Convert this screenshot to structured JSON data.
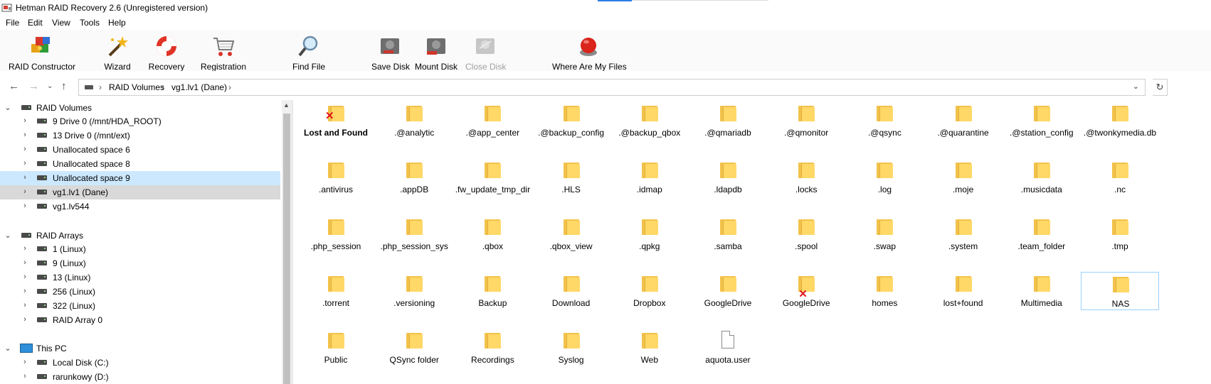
{
  "window": {
    "title": "Hetman RAID Recovery 2.6 (Unregistered version)"
  },
  "menu": [
    "File",
    "Edit",
    "View",
    "Tools",
    "Help"
  ],
  "toolbar": [
    {
      "label": "RAID Constructor",
      "icon": "raid-constructor-icon",
      "enabled": true
    },
    {
      "label": "Wizard",
      "icon": "wizard-icon",
      "enabled": true
    },
    {
      "label": "Recovery",
      "icon": "recovery-lifebuoy-icon",
      "enabled": true
    },
    {
      "label": "Registration",
      "icon": "cart-icon",
      "enabled": true
    },
    {
      "label": "Find File",
      "icon": "magnifier-icon",
      "enabled": true
    },
    {
      "label": "Save Disk",
      "icon": "save-disk-icon",
      "enabled": true
    },
    {
      "label": "Mount Disk",
      "icon": "mount-disk-icon",
      "enabled": true
    },
    {
      "label": "Close Disk",
      "icon": "close-disk-icon",
      "enabled": false
    },
    {
      "label": "Where Are My Files",
      "icon": "help-button-icon",
      "enabled": true
    }
  ],
  "address": {
    "segments": [
      "RAID Volumes",
      "vg1.lv1 (Dane)"
    ]
  },
  "tree": {
    "raid_volumes": {
      "label": "RAID Volumes",
      "items": [
        "9 Drive 0 (/mnt/HDA_ROOT)",
        "13 Drive 0 (/mnt/ext)",
        "Unallocated space 6",
        "Unallocated space 8",
        "Unallocated space 9",
        "vg1.lv1 (Dane)",
        "vg1.lv544"
      ]
    },
    "raid_arrays": {
      "label": "RAID Arrays",
      "items": [
        "1 (Linux)",
        "9 (Linux)",
        "13 (Linux)",
        "256 (Linux)",
        "322 (Linux)",
        "RAID Array 0"
      ]
    },
    "this_pc": {
      "label": "This PC",
      "items": [
        "Local Disk (C:)",
        "rarunkowy (D:)"
      ]
    }
  },
  "files": [
    {
      "name": "Lost and Found",
      "type": "folder",
      "deleted": true,
      "bold": true
    },
    {
      "name": ".@analytic",
      "type": "folder"
    },
    {
      "name": ".@app_center",
      "type": "folder"
    },
    {
      "name": ".@backup_config",
      "type": "folder"
    },
    {
      "name": ".@backup_qbox",
      "type": "folder"
    },
    {
      "name": ".@qmariadb",
      "type": "folder"
    },
    {
      "name": ".@qmonitor",
      "type": "folder"
    },
    {
      "name": ".@qsync",
      "type": "folder"
    },
    {
      "name": ".@quarantine",
      "type": "folder"
    },
    {
      "name": ".@station_config",
      "type": "folder"
    },
    {
      "name": ".@twonkymedia.db",
      "type": "folder"
    },
    {
      "name": ".antivirus",
      "type": "folder"
    },
    {
      "name": ".appDB",
      "type": "folder"
    },
    {
      "name": ".fw_update_tmp_dir",
      "type": "folder"
    },
    {
      "name": ".HLS",
      "type": "folder"
    },
    {
      "name": ".idmap",
      "type": "folder"
    },
    {
      "name": ".ldapdb",
      "type": "folder"
    },
    {
      "name": ".locks",
      "type": "folder"
    },
    {
      "name": ".log",
      "type": "folder"
    },
    {
      "name": ".moje",
      "type": "folder"
    },
    {
      "name": ".musicdata",
      "type": "folder"
    },
    {
      "name": ".nc",
      "type": "folder"
    },
    {
      "name": ".php_session",
      "type": "folder"
    },
    {
      "name": ".php_session_sys",
      "type": "folder"
    },
    {
      "name": ".qbox",
      "type": "folder"
    },
    {
      "name": ".qbox_view",
      "type": "folder"
    },
    {
      "name": ".qpkg",
      "type": "folder"
    },
    {
      "name": ".samba",
      "type": "folder"
    },
    {
      "name": ".spool",
      "type": "folder"
    },
    {
      "name": ".swap",
      "type": "folder"
    },
    {
      "name": ".system",
      "type": "folder"
    },
    {
      "name": ".team_folder",
      "type": "folder"
    },
    {
      "name": ".tmp",
      "type": "folder"
    },
    {
      "name": ".torrent",
      "type": "folder"
    },
    {
      "name": ".versioning",
      "type": "folder"
    },
    {
      "name": "Backup",
      "type": "folder"
    },
    {
      "name": "Download",
      "type": "folder"
    },
    {
      "name": "Dropbox",
      "type": "folder"
    },
    {
      "name": "GoogleDrive",
      "type": "folder"
    },
    {
      "name": "GoogleDrive",
      "type": "folder",
      "deleted": true
    },
    {
      "name": "homes",
      "type": "folder"
    },
    {
      "name": "lost+found",
      "type": "folder"
    },
    {
      "name": "Multimedia",
      "type": "folder"
    },
    {
      "name": "NAS",
      "type": "folder",
      "selected": true
    },
    {
      "name": "Public",
      "type": "folder"
    },
    {
      "name": "QSync folder",
      "type": "folder"
    },
    {
      "name": "Recordings",
      "type": "folder"
    },
    {
      "name": "Syslog",
      "type": "folder"
    },
    {
      "name": "Web",
      "type": "folder"
    },
    {
      "name": "aquota.user",
      "type": "file"
    }
  ],
  "colors": {
    "selection": "#cce8ff",
    "active_row": "#d9d9d9",
    "deleted_mark": "#e0161c",
    "folder": "#ffd867"
  }
}
